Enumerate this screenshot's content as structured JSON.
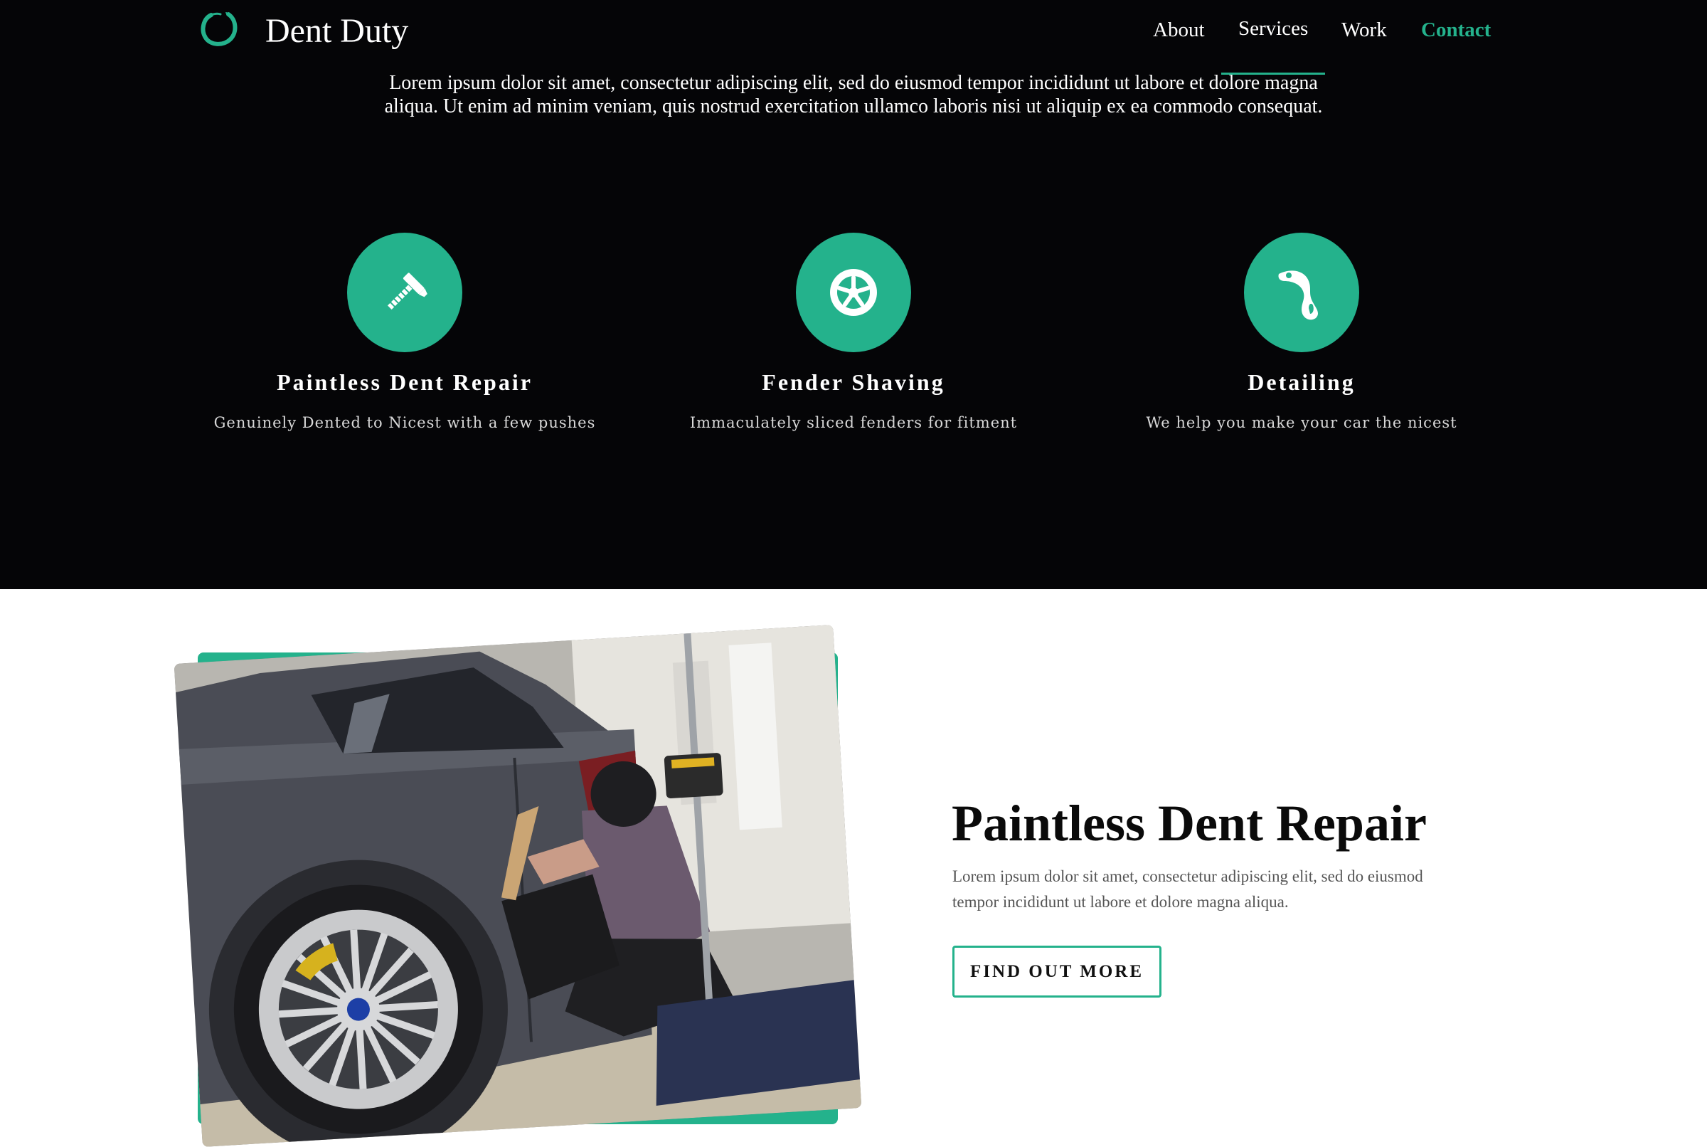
{
  "colors": {
    "accent": "#24b28c",
    "dark_bg": "#050507",
    "light_bg": "#ffffff"
  },
  "nav": {
    "brand": "Dent Duty",
    "logo_icon": "ring-logo-icon",
    "links": [
      {
        "label": "About"
      },
      {
        "label": "Services",
        "active": true
      },
      {
        "label": "Work"
      },
      {
        "label": "Contact",
        "highlight": true
      }
    ]
  },
  "intro": {
    "text": "Lorem ipsum dolor sit amet, consectetur adipiscing elit, sed do eiusmod tempor incididunt ut labore et dolore magna aliqua. Ut enim ad minim veniam, quis nostrud exercitation ullamco laboris nisi ut aliquip ex ea commodo consequat."
  },
  "services": [
    {
      "icon": "hammer-icon",
      "title": "Paintless Dent Repair",
      "description": "Genuinely Dented to Nicest with a few pushes"
    },
    {
      "icon": "wheel-icon",
      "title": "Fender Shaving",
      "description": "Immaculately sliced fenders for fitment"
    },
    {
      "icon": "droplet-icon",
      "title": "Detailing",
      "description": "We help you make your car the nicest"
    }
  ],
  "feature": {
    "image_icon": "car-dent-repair-photo",
    "title": "Paintless Dent Repair",
    "text": "Lorem ipsum dolor sit amet, consectetur adipiscing elit, sed do eiusmod tempor incididunt ut labore et dolore magna aliqua.",
    "button_label": "FIND OUT MORE"
  }
}
